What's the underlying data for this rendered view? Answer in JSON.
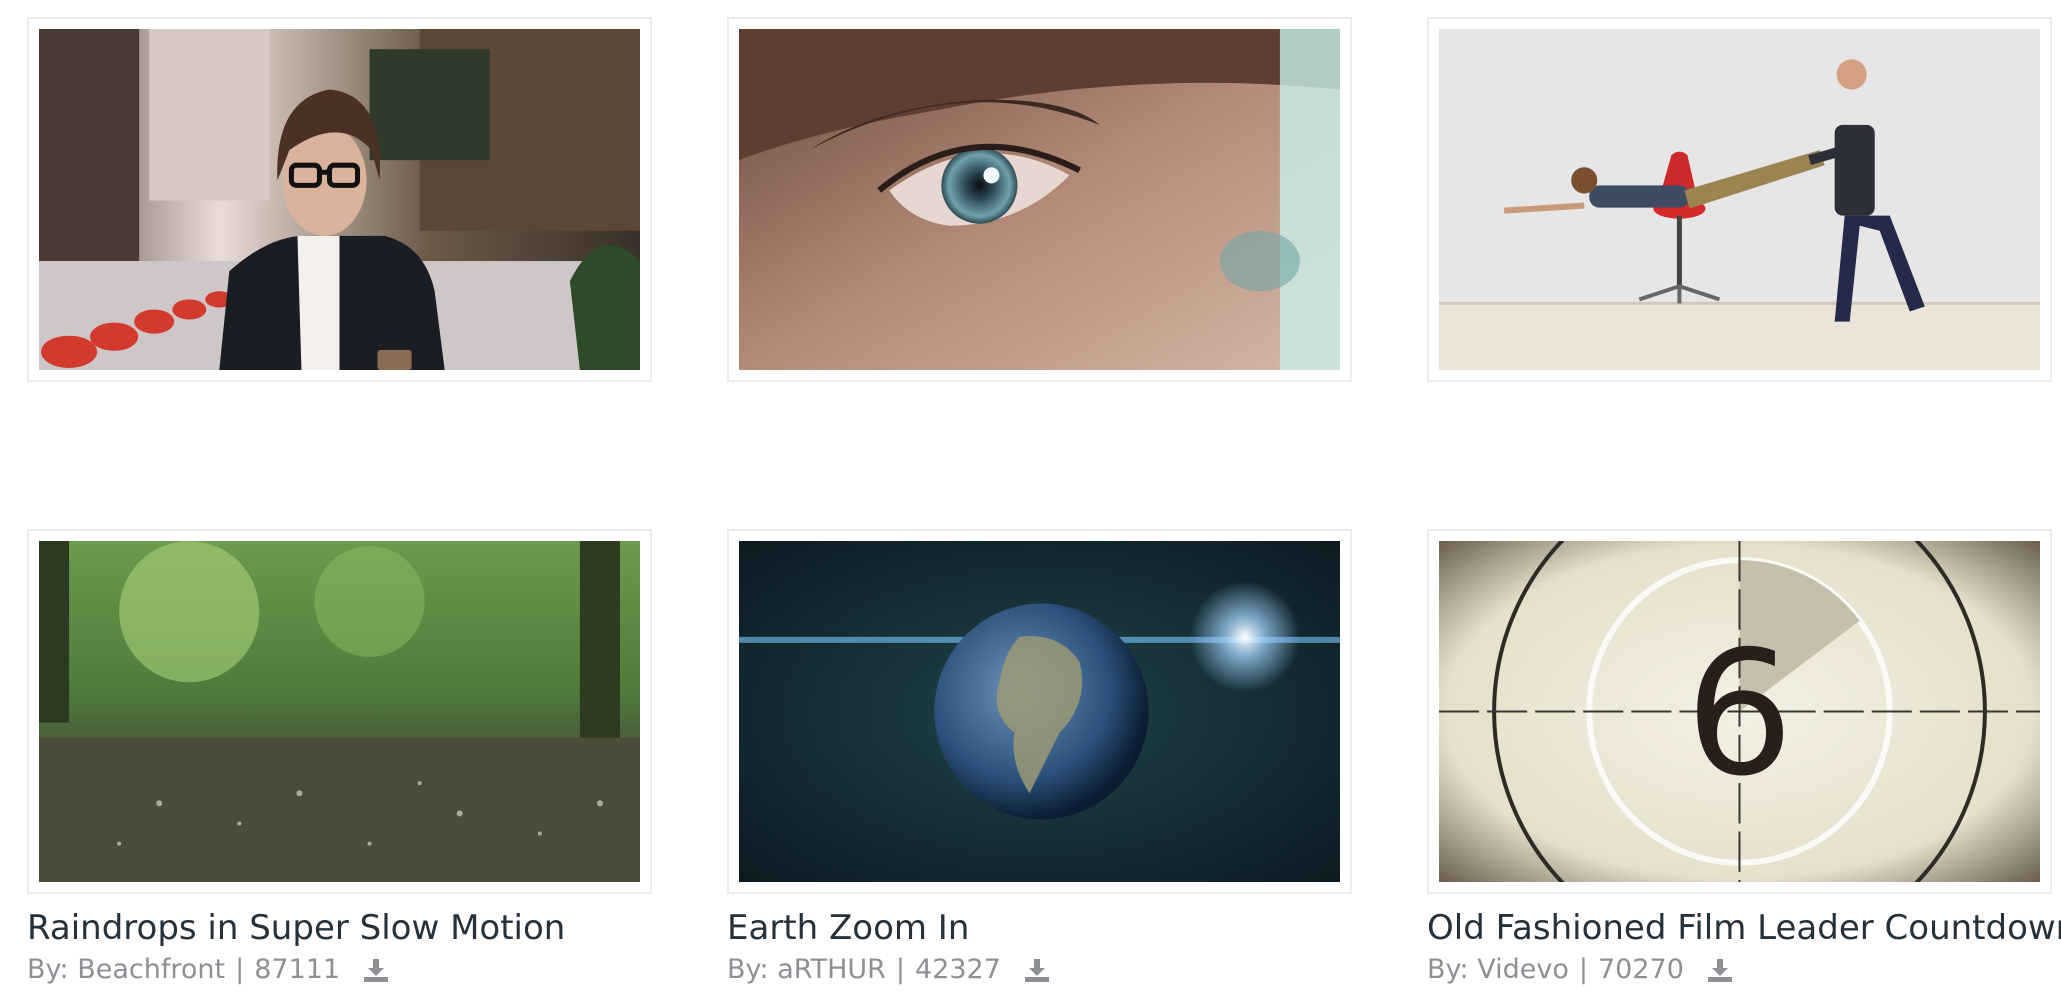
{
  "videos": [
    {
      "title": "",
      "by_prefix": "",
      "author": "",
      "views": "",
      "image": "woman-with-glasses-in-city",
      "has_caption": false
    },
    {
      "title": "",
      "by_prefix": "",
      "author": "",
      "views": "",
      "image": "close-up-eye",
      "has_caption": false
    },
    {
      "title": "",
      "by_prefix": "",
      "author": "",
      "views": "",
      "image": "men-playing-with-office-chair",
      "has_caption": false
    },
    {
      "title": "Raindrops in Super Slow Motion",
      "by_prefix": "By:",
      "author": "Beachfront",
      "views": "87111",
      "image": "raindrops-on-ground",
      "has_caption": true
    },
    {
      "title": "Earth Zoom In",
      "by_prefix": "By:",
      "author": "aRTHUR",
      "views": "42327",
      "image": "earth-in-space",
      "has_caption": true
    },
    {
      "title": "Old Fashioned Film Leader Countdown",
      "by_prefix": "By:",
      "author": "Videvo",
      "views": "70270",
      "image": "film-leader-countdown-6",
      "has_caption": true
    }
  ],
  "countdown_number": "6",
  "separator": "|",
  "icons": {
    "download": "download-icon"
  },
  "colors": {
    "title": "#25313b",
    "meta": "#8d9195",
    "border": "#ececec"
  }
}
